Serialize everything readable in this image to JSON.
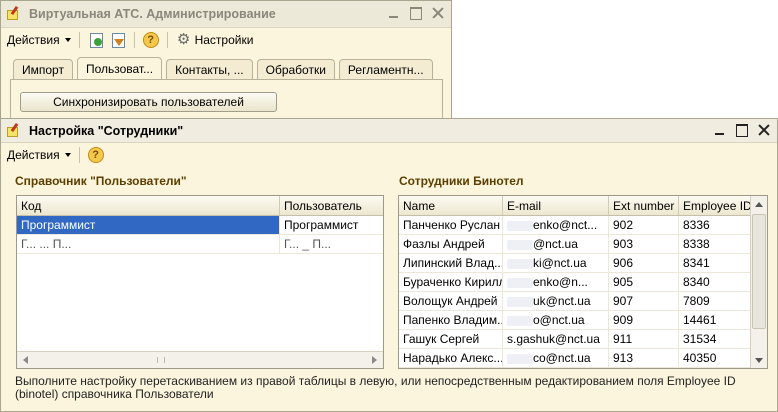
{
  "back_window": {
    "title": "Виртуальная АТС. Администрирование",
    "toolbar": {
      "actions_label": "Действия",
      "help_glyph": "?",
      "settings_label": "Настройки"
    },
    "tabs": [
      {
        "label": "Импорт",
        "active": false
      },
      {
        "label": "Пользоват...",
        "active": true
      },
      {
        "label": "Контакты, ...",
        "active": false
      },
      {
        "label": "Обработки",
        "active": false
      },
      {
        "label": "Регламентн...",
        "active": false
      }
    ],
    "sync_button": "Синхронизировать пользователей"
  },
  "front_window": {
    "title": "Настройка \"Сотрудники\"",
    "toolbar": {
      "actions_label": "Действия",
      "help_glyph": "?"
    },
    "users_section": {
      "title": "Справочник \"Пользователи\"",
      "columns": [
        "Код",
        "Пользователь"
      ],
      "rows": [
        {
          "code": "Программист",
          "user": "Программист",
          "selected": true
        },
        {
          "code": "Г...   ...  П...",
          "user": "Г...   _ П...",
          "selected": false
        }
      ]
    },
    "employees_section": {
      "title": "Сотрудники Бинотел",
      "columns": [
        "Name",
        "E-mail",
        "Ext number",
        "Employee ID"
      ],
      "rows": [
        {
          "name": "Панченко Руслан",
          "email": "enko@nct...",
          "ext": "902",
          "id": "8336"
        },
        {
          "name": "Фазлы Андрей",
          "email": "@nct.ua",
          "ext": "903",
          "id": "8338"
        },
        {
          "name": "Липинский Влад...",
          "email": "ki@nct.ua",
          "ext": "906",
          "id": "8341"
        },
        {
          "name": "Бураченко Кирилл",
          "email": "enko@n...",
          "ext": "905",
          "id": "8340"
        },
        {
          "name": "Волощук Андрей",
          "email": "uk@nct.ua",
          "ext": "907",
          "id": "7809"
        },
        {
          "name": "Папенко Владим...",
          "email": "o@nct.ua",
          "ext": "909",
          "id": "14461"
        },
        {
          "name": "Гашук Сергей",
          "email": "s.gashuk@nct.ua",
          "ext": "911",
          "id": "31534"
        },
        {
          "name": "Нарадько Алекс...",
          "email": "co@nct.ua",
          "ext": "913",
          "id": "40350"
        }
      ]
    },
    "hint": "Выполните настройку перетаскиванием из правой таблицы в левую, или непосредственным редактированием поля Employee ID (binotel) справочника Пользователи"
  },
  "colors": {
    "window_bg": "#fbf5de",
    "section_title": "#5b3f00",
    "selection": "#3168c4"
  }
}
